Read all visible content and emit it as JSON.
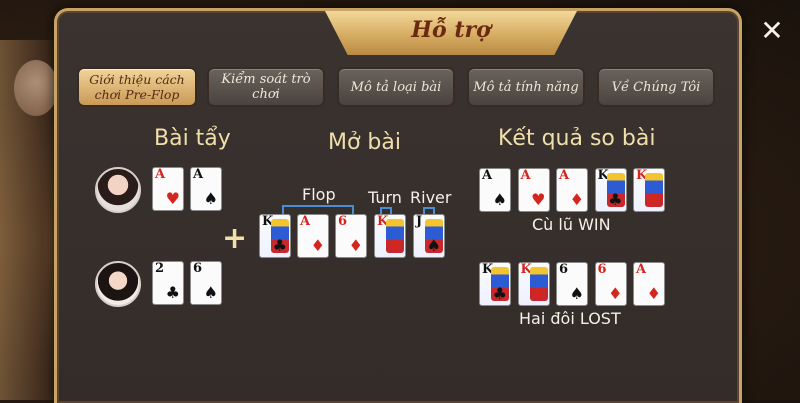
{
  "dialog": {
    "title": "Hỗ trợ",
    "close_glyph": "✕"
  },
  "tabs": [
    {
      "label": "Giới thiệu cách chơi Pre-Flop",
      "active": true
    },
    {
      "label": "Kiểm soát trò chơi",
      "active": false
    },
    {
      "label": "Mô tả loại bài",
      "active": false
    },
    {
      "label": "Mô tả tính năng",
      "active": false
    },
    {
      "label": "Về Chúng Tôi",
      "active": false
    }
  ],
  "sections": {
    "hole_cards": "Bài tẩy",
    "board": "Mở bài",
    "result": "Kết quả so bài"
  },
  "board_labels": {
    "flop": "Flop",
    "turn": "Turn",
    "river": "River"
  },
  "players": [
    {
      "hole": [
        {
          "rank": "A",
          "suit": "♥"
        },
        {
          "rank": "A",
          "suit": "♠"
        }
      ]
    },
    {
      "hole": [
        {
          "rank": "2",
          "suit": "♣"
        },
        {
          "rank": "6",
          "suit": "♠"
        }
      ]
    }
  ],
  "board_cards": [
    {
      "rank": "K",
      "suit": "♣"
    },
    {
      "rank": "A",
      "suit": "♦"
    },
    {
      "rank": "6",
      "suit": "♦"
    },
    {
      "rank": "K",
      "suit": "♦"
    },
    {
      "rank": "J",
      "suit": "♠"
    }
  ],
  "results": [
    {
      "cards": [
        {
          "rank": "A",
          "suit": "♠"
        },
        {
          "rank": "A",
          "suit": "♥"
        },
        {
          "rank": "A",
          "suit": "♦"
        },
        {
          "rank": "K",
          "suit": "♣"
        },
        {
          "rank": "K",
          "suit": "♦"
        }
      ],
      "text": "Cù lũ WIN"
    },
    {
      "cards": [
        {
          "rank": "K",
          "suit": "♣"
        },
        {
          "rank": "K",
          "suit": "♦"
        },
        {
          "rank": "6",
          "suit": "♠"
        },
        {
          "rank": "6",
          "suit": "♦"
        },
        {
          "rank": "A",
          "suit": "♦"
        }
      ],
      "text": "Hai đôi LOST"
    }
  ],
  "plus_glyph": "+",
  "colors": {
    "gold": "#c9a265",
    "heading": "#f1dfaa",
    "red_suit": "#d4261f",
    "bracket": "#4a8cd6"
  }
}
